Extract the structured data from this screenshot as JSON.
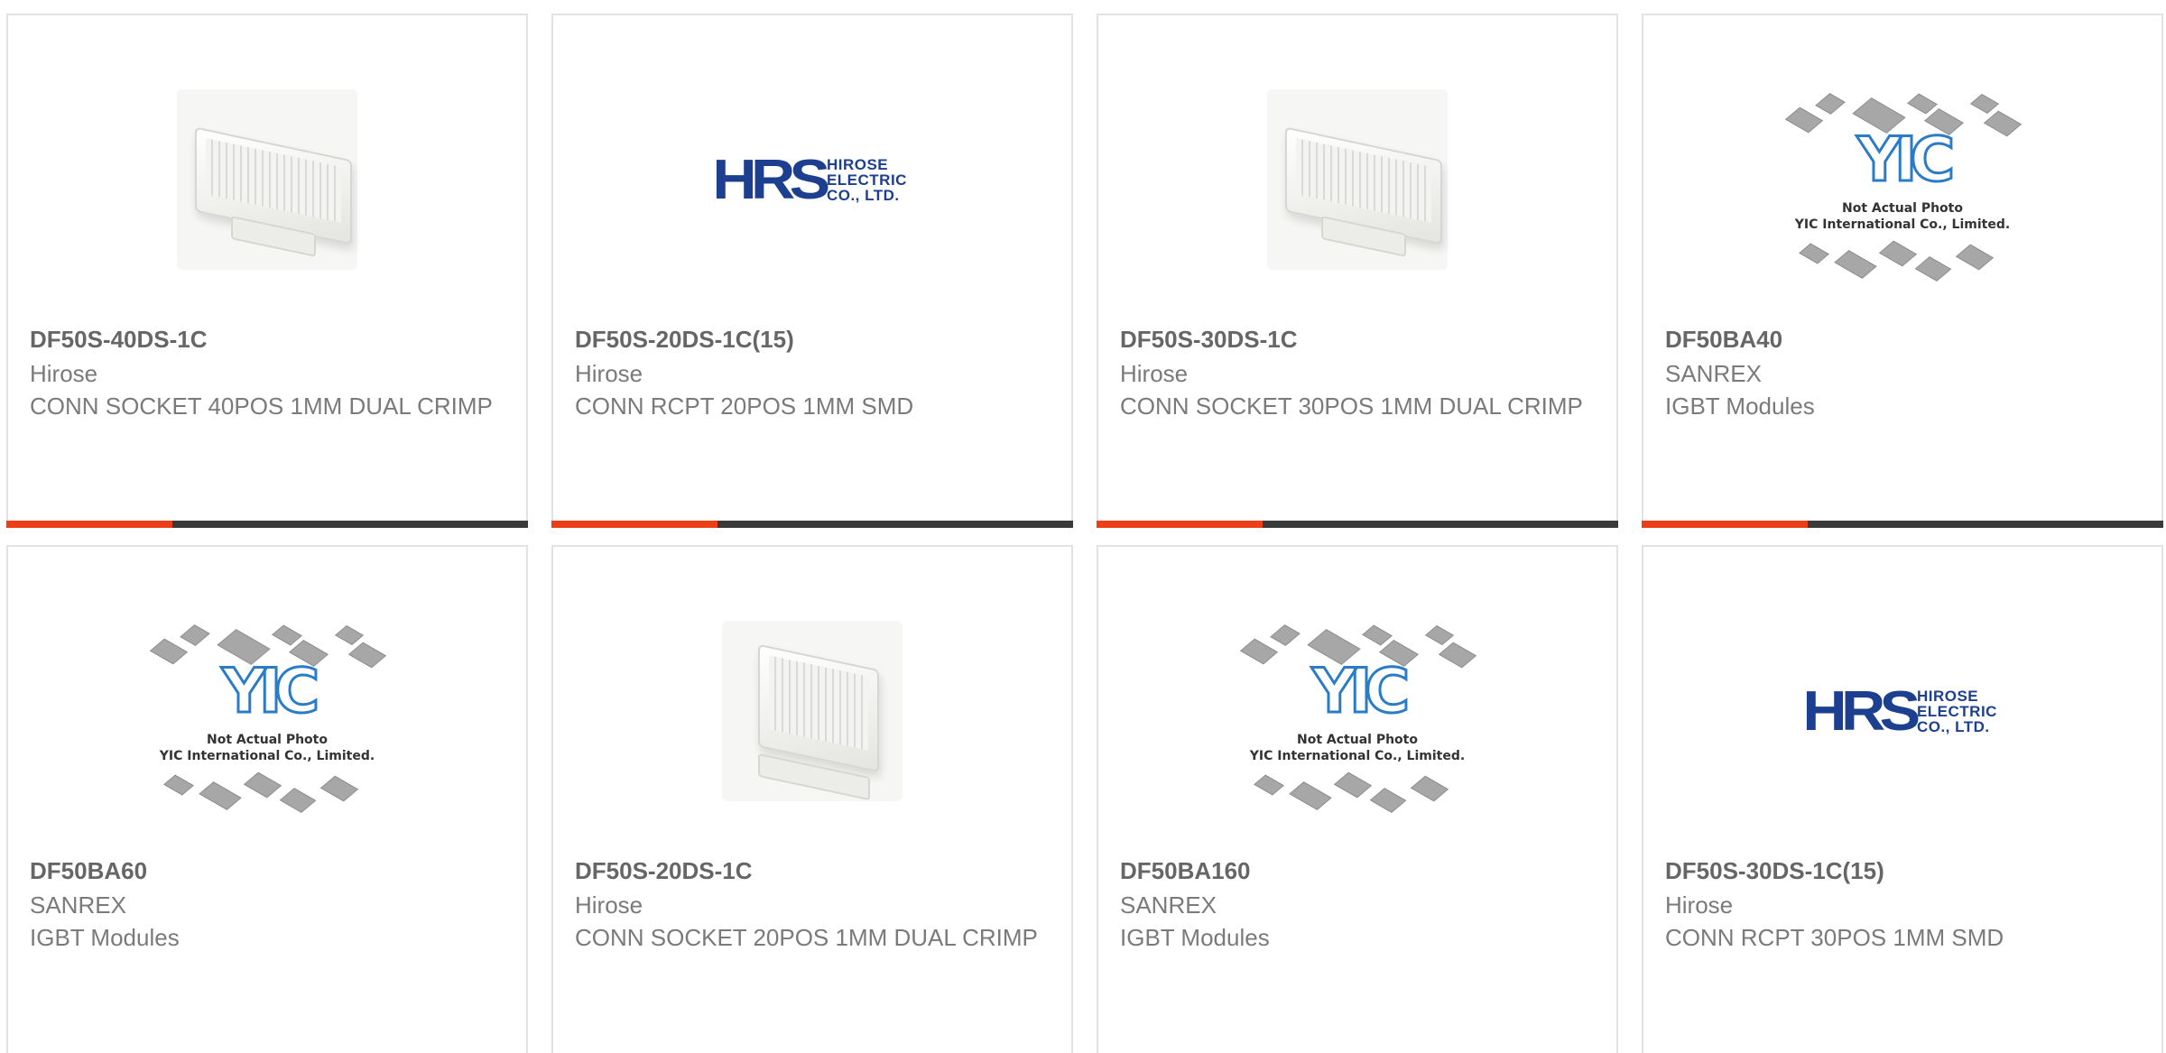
{
  "cards": [
    {
      "part": "DF50S-40DS-1C",
      "manufacturer": "Hirose",
      "description": "CONN SOCKET 40POS 1MM DUAL CRIMP",
      "image": "connector-photo"
    },
    {
      "part": "DF50S-20DS-1C(15)",
      "manufacturer": "Hirose",
      "description": "CONN RCPT 20POS 1MM SMD",
      "image": "hrs-logo"
    },
    {
      "part": "DF50S-30DS-1C",
      "manufacturer": "Hirose",
      "description": "CONN SOCKET 30POS 1MM DUAL CRIMP",
      "image": "connector-photo"
    },
    {
      "part": "DF50BA40",
      "manufacturer": "SANREX",
      "description": "IGBT Modules",
      "image": "yic-placeholder"
    },
    {
      "part": "DF50BA60",
      "manufacturer": "SANREX",
      "description": "IGBT Modules",
      "image": "yic-placeholder"
    },
    {
      "part": "DF50S-20DS-1C",
      "manufacturer": "Hirose",
      "description": "CONN SOCKET 20POS 1MM DUAL CRIMP",
      "image": "connector-photo"
    },
    {
      "part": "DF50BA160",
      "manufacturer": "SANREX",
      "description": "IGBT Modules",
      "image": "yic-placeholder"
    },
    {
      "part": "DF50S-30DS-1C(15)",
      "manufacturer": "Hirose",
      "description": "CONN RCPT 30POS 1MM SMD",
      "image": "hrs-logo"
    }
  ],
  "hrs_logo": {
    "mark": "HRS",
    "line1": "HIROSE",
    "line2": "ELECTRIC",
    "line3": "CO., LTD."
  },
  "yic_placeholder": {
    "logo": "YIC",
    "line1": "Not Actual Photo",
    "line2": "YIC International Co., Limited."
  },
  "colors": {
    "accent": "#ea3f17",
    "bar": "#3a3a3a",
    "part_text": "#666666",
    "body_text": "#7a7a7a",
    "hrs_blue": "#1d3f8f",
    "yic_blue": "#2a7cc7"
  }
}
